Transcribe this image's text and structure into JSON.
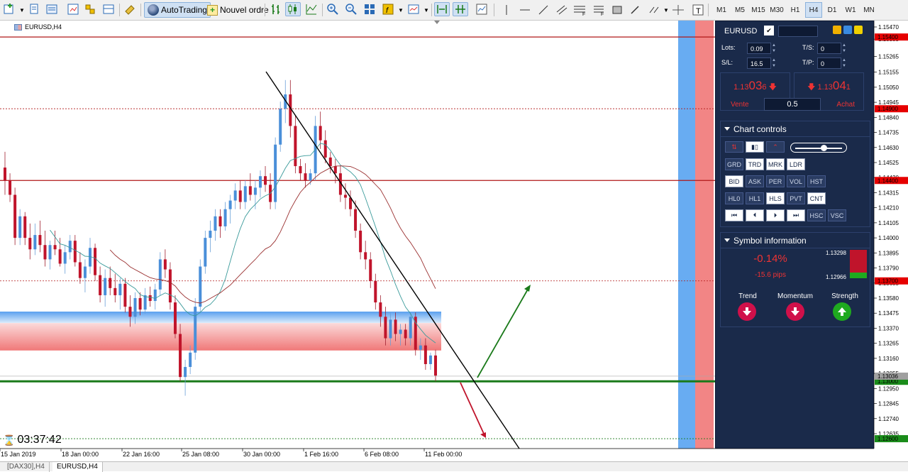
{
  "toolbar": {
    "autotrading_label": "AutoTrading",
    "new_order_label": "Nouvel ordre",
    "timeframes": [
      "M1",
      "M5",
      "M15",
      "M30",
      "H1",
      "H4",
      "D1",
      "W1",
      "MN"
    ],
    "active_timeframe": "H4"
  },
  "chart": {
    "symbol_label": "EURUSD,H4",
    "timer": "03:37:42",
    "price_axis": [
      "1.15470",
      "1.15385",
      "1.15265",
      "1.15155",
      "1.15050",
      "1.14945",
      "1.14840",
      "1.14735",
      "1.14630",
      "1.14525",
      "1.14420",
      "1.14315",
      "1.14210",
      "1.14105",
      "1.14000",
      "1.13895",
      "1.13790",
      "1.13685",
      "1.13580",
      "1.13475",
      "1.13370",
      "1.13265",
      "1.13160",
      "1.13055",
      "1.12950",
      "1.12845",
      "1.12740",
      "1.12635"
    ],
    "price_tags": [
      {
        "label": "1.15400",
        "color": "#e60000"
      },
      {
        "label": "1.14900",
        "color": "#e60000"
      },
      {
        "label": "1.14400",
        "color": "#e60000"
      },
      {
        "label": "1.13700",
        "color": "#e60000"
      },
      {
        "label": "1.13000",
        "color": "#1a8c1a"
      },
      {
        "label": "1.12600",
        "color": "#1a8c1a"
      }
    ],
    "bid_tag": "1.13036",
    "time_axis": [
      "15 Jan 2019",
      "18 Jan 00:00",
      "22 Jan 16:00",
      "25 Jan 08:00",
      "30 Jan 00:00",
      "1 Feb 16:00",
      "6 Feb 08:00",
      "11 Feb 00:00"
    ]
  },
  "panel": {
    "symbol": "EURUSD",
    "lots_label": "Lots:",
    "lots_value": "0.09",
    "sl_label": "S/L:",
    "sl_value": "16.5",
    "ts_label": "T/S:",
    "ts_value": "0",
    "tp_label": "T/P:",
    "tp_value": "0",
    "sell_price_prefix": "1.13",
    "sell_price_main": "03",
    "sell_price_suffix": "6",
    "buy_price_prefix": "1.13",
    "buy_price_main": "04",
    "buy_price_suffix": "1",
    "sell_label": "Vente",
    "buy_label": "Achat",
    "spread": "0.5",
    "chart_controls_title": "Chart controls",
    "row1": [
      "GRD",
      "TRD",
      "MRK",
      "LDR"
    ],
    "row2": [
      "BID",
      "ASK",
      "PER",
      "VOL",
      "HST"
    ],
    "row3": [
      "HL0",
      "HL1",
      "HLS",
      "PVT",
      "CNT"
    ],
    "row4_last": [
      "HSC",
      "VSC"
    ],
    "symbol_info_title": "Symbol information",
    "change_pct": "-0.14%",
    "change_pips": "-15.6 pips",
    "high": "1.13298",
    "low": "1.12966",
    "trend_label": "Trend",
    "momentum_label": "Momentum",
    "strength_label": "Strength"
  },
  "bottom_tabs": [
    "[DAX30],H4",
    "EURUSD,H4"
  ],
  "colors": {
    "panel_bg": "#1a2a4a",
    "bull": "#4a8fd9",
    "bear": "#c0142b",
    "support": "#1a8c1a"
  }
}
